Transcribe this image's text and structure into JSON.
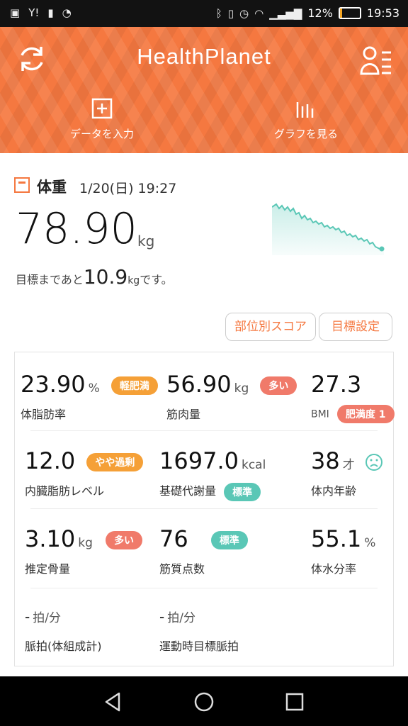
{
  "status_bar": {
    "left_icons": [
      "line-icon",
      "yahoo-icon",
      "battery-alert-icon",
      "download-icon"
    ],
    "right_icons": [
      "bluetooth-icon",
      "vibrate-icon",
      "alarm-icon",
      "wifi-icon",
      "signal-icon"
    ],
    "battery_percent_text": "12%",
    "battery_level": 0.12,
    "time": "19:53"
  },
  "header": {
    "app_title": "HealthPlanet",
    "actions": [
      {
        "label": "データを入力",
        "icon": "plus-box-icon"
      },
      {
        "label": "グラフを見る",
        "icon": "bar-chart-icon"
      }
    ],
    "accent_color": "#f57840"
  },
  "weight": {
    "label": "体重",
    "date": "1/20(日) 19:27",
    "value": "78.90",
    "unit": "kg",
    "goal_prefix": "目標まであと",
    "goal_number": "10.9",
    "goal_unit": "kg",
    "goal_suffix": "です。"
  },
  "buttons": {
    "body_part_score": "部位別スコア",
    "goal_setting": "目標設定"
  },
  "metrics": {
    "body_fat": {
      "value": "23.90",
      "unit": "%",
      "label": "体脂肪率",
      "badge": "軽肥満"
    },
    "muscle": {
      "value": "56.90",
      "unit": "kg",
      "label": "筋肉量",
      "badge": "多い"
    },
    "bmi": {
      "value": "27.3",
      "label": "BMI",
      "badge": "肥満度 1"
    },
    "visceral_fat": {
      "value": "12.0",
      "label": "内臓脂肪レベル",
      "badge": "やや過剰"
    },
    "bmr": {
      "value": "1697.0",
      "unit": "kcal",
      "label": "基礎代謝量",
      "badge": "標準"
    },
    "body_age": {
      "value": "38",
      "unit": "才",
      "label": "体内年齢"
    },
    "bone": {
      "value": "3.10",
      "unit": "kg",
      "label": "推定骨量",
      "badge": "多い"
    },
    "muscle_quality": {
      "value": "76",
      "label": "筋質点数",
      "badge": "標準"
    },
    "water": {
      "value": "55.1",
      "unit": "%",
      "label": "体水分率"
    },
    "pulse": {
      "value": "-",
      "unit": "拍/分",
      "label": "脈拍(体組成計)"
    },
    "target_pulse": {
      "value": "-",
      "unit": "拍/分",
      "label": "運動時目標脈拍"
    }
  },
  "nav": {
    "icons": [
      "back-icon",
      "home-icon",
      "recents-icon"
    ]
  }
}
